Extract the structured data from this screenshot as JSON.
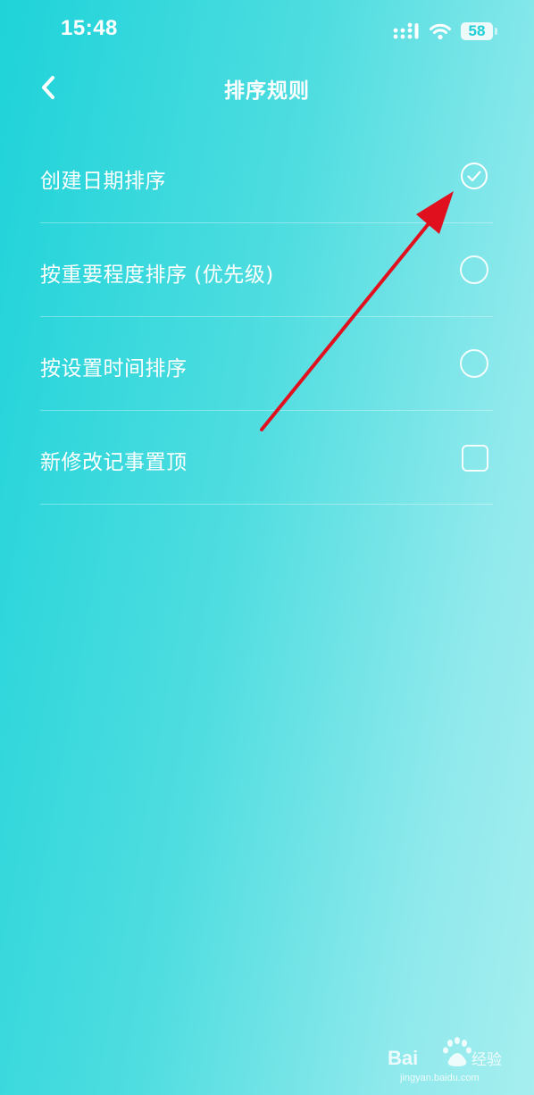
{
  "status_bar": {
    "time": "15:48",
    "battery": "58",
    "icons": [
      "signal-icon",
      "wifi-icon",
      "battery-icon"
    ]
  },
  "header": {
    "title": "排序规则",
    "back_icon": "chevron-left-icon"
  },
  "options": [
    {
      "label": "创建日期排序",
      "control": "radio",
      "selected": true
    },
    {
      "label": "按重要程度排序 (优先级)",
      "control": "radio",
      "selected": false
    },
    {
      "label": "按设置时间排序",
      "control": "radio",
      "selected": false
    },
    {
      "label": "新修改记事置顶",
      "control": "checkbox",
      "selected": false
    }
  ],
  "annotation": {
    "color": "#e0101f",
    "icon": "red-arrow"
  },
  "watermark": {
    "brand": "Baidu经验",
    "url": "jingyan.baidu.com"
  },
  "colors": {
    "gradient_start": "#1ed3d9",
    "gradient_end": "#a6eeef",
    "text": "#ffffff"
  }
}
